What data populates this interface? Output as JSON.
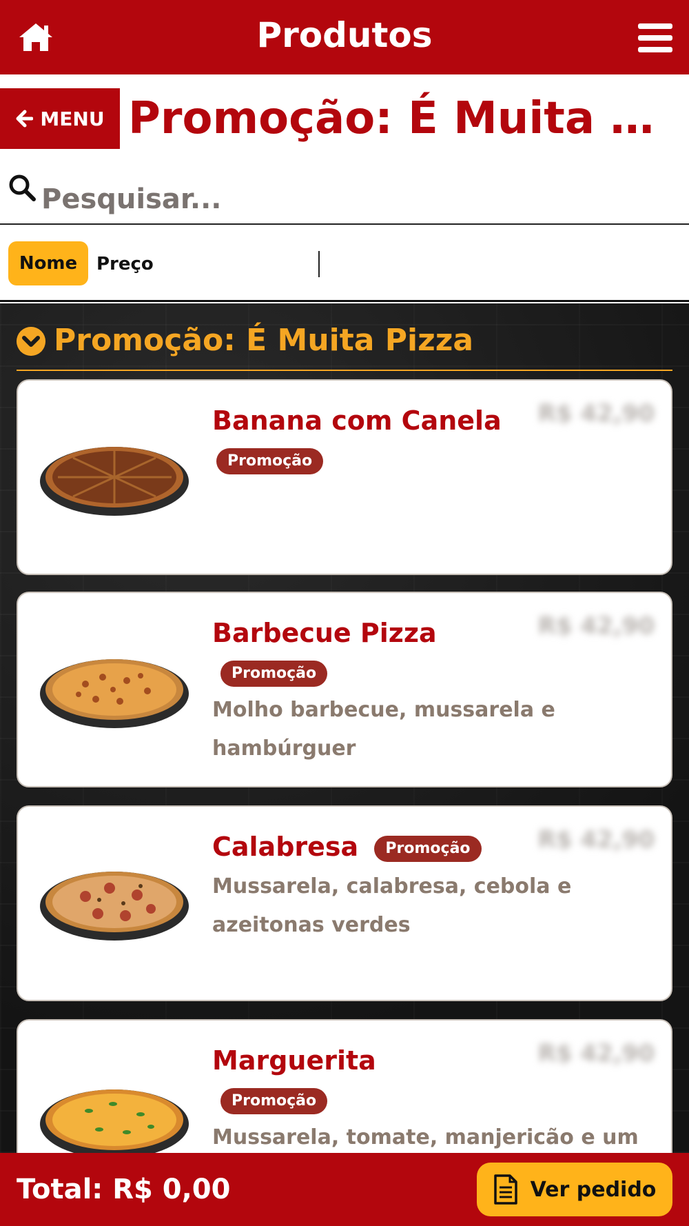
{
  "header": {
    "title": "Produtos",
    "home_icon": "home-icon",
    "menu_icon": "hamburger-icon",
    "bg_color": "#b3060d"
  },
  "category_bar": {
    "menu_label": "MENU",
    "back_icon": "arrow-left-icon",
    "title": "Promoção: É Muita Piz..."
  },
  "search": {
    "placeholder": "Pesquisar...",
    "icon": "search-icon"
  },
  "sort": {
    "options": [
      "Nome",
      "Preço"
    ],
    "active": "Nome",
    "active_color": "#ffb31a"
  },
  "section": {
    "title": "Promoção: É Muita Pizza",
    "icon": "chevron-down-circle-icon",
    "color": "#f5a623"
  },
  "products": [
    {
      "name": "Banana com Canela",
      "badge": "Promoção",
      "price": "R$ 42,90",
      "description": ""
    },
    {
      "name": "Barbecue Pizza",
      "badge": "Promoção",
      "price": "R$ 42,90",
      "description": "Molho barbecue, mussarela e hambúrguer"
    },
    {
      "name": "Calabresa",
      "badge": "Promoção",
      "price": "R$ 42,90",
      "description": "Mussarela, calabresa, cebola e azeitonas verdes"
    },
    {
      "name": "Marguerita",
      "badge": "Promoção",
      "price": "R$ 42,90",
      "description": "Mussarela, tomate, manjericão e um"
    }
  ],
  "footer": {
    "total": "Total: R$ 0,00",
    "order_button": "Ver pedido",
    "order_icon": "document-icon"
  }
}
